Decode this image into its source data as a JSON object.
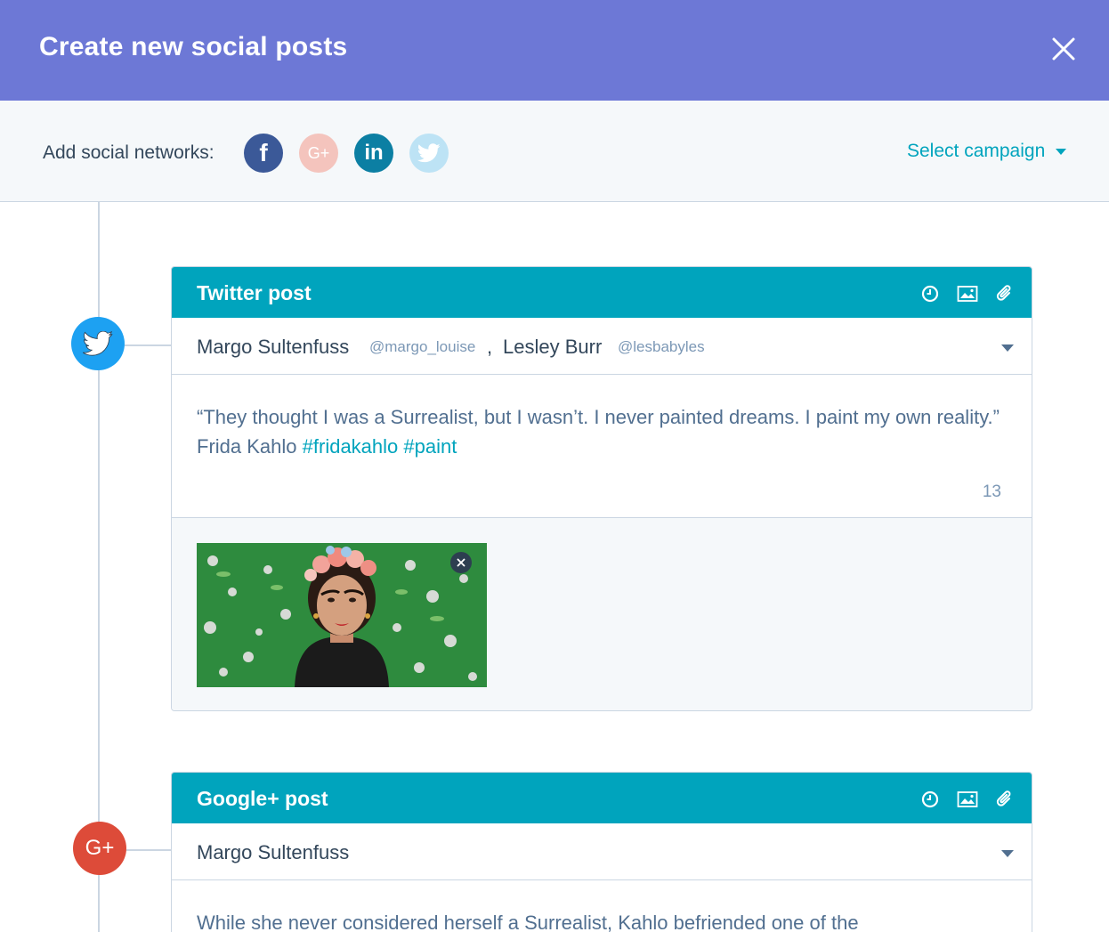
{
  "header": {
    "title": "Create new social posts"
  },
  "networks": {
    "label": "Add social networks:",
    "items": [
      {
        "name": "facebook",
        "glyph": "f"
      },
      {
        "name": "google-plus",
        "glyph": "G+"
      },
      {
        "name": "linkedin",
        "glyph": "in"
      },
      {
        "name": "twitter",
        "glyph": ""
      }
    ],
    "campaign": "Select campaign"
  },
  "posts": [
    {
      "title": "Twitter post",
      "accounts": [
        {
          "name": "Margo Sultenfuss",
          "handle": "@margo_louise"
        },
        {
          "name": "Lesley Burr",
          "handle": "@lesbabyles"
        }
      ],
      "separator": ",",
      "message": "“They thought I was a Surrealist, but I wasn’t. I never painted dreams. I paint my own reality.” Frida Kahlo",
      "hashtags": [
        "#fridakahlo",
        "#paint"
      ],
      "char_count": "13"
    },
    {
      "title": "Google+ post",
      "accounts": [
        {
          "name": "Margo Sultenfuss"
        }
      ],
      "message": "While she never considered herself a Surrealist, Kahlo befriended one of the"
    }
  ],
  "colors": {
    "header": "#6d78d6",
    "accent": "#00a4bd",
    "facebook": "#3b5998",
    "linkedin": "#0c7fa3",
    "twitter": "#1da1f2",
    "google_plus": "#dd4b39"
  }
}
